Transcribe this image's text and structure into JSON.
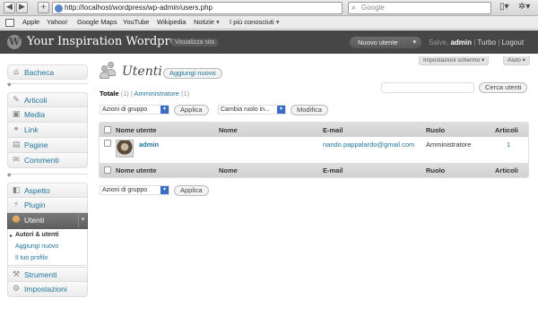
{
  "browser": {
    "back_glyph": "◀",
    "forward_glyph": "▶",
    "add_tab_glyph": "+",
    "url": "http://localhost/wordpress/wp-admin/users.php",
    "search_placeholder": "Google",
    "search_glyph": "⌕",
    "page_menu_glyph": "▯▾",
    "tools_menu_glyph": "✲▾",
    "bookmarks": [
      "Apple",
      "Yahoo!",
      "Google Maps",
      "YouTube",
      "Wikipedia",
      "Notizie",
      "I più conosciuti"
    ],
    "bookmark_folders": [
      "Notizie",
      "I più conosciuti"
    ]
  },
  "header": {
    "logo_letter": "W",
    "site_title": "Your Inspiration Wordpress",
    "visit_site": "Visualizza sito",
    "new_user_button": "Nuovo utente",
    "new_user_arrow": "▾",
    "greeting": "Salve,",
    "username": "admin",
    "sep": "|",
    "turbo": "Turbo",
    "logout": "Logout",
    "screen_options": "Impostazioni schermo",
    "help": "Aiuto"
  },
  "sidebar": {
    "items": [
      {
        "label": "Bacheca",
        "icon": "dashboard-icon",
        "glyph": "⌂"
      },
      {
        "label": "Articoli",
        "icon": "posts-icon",
        "glyph": "✎"
      },
      {
        "label": "Media",
        "icon": "media-icon",
        "glyph": "▣"
      },
      {
        "label": "Link",
        "icon": "link-icon",
        "glyph": "⚭"
      },
      {
        "label": "Pagine",
        "icon": "pages-icon",
        "glyph": "▤"
      },
      {
        "label": "Commenti",
        "icon": "comments-icon",
        "glyph": "✉"
      },
      {
        "label": "Aspetto",
        "icon": "appearance-icon",
        "glyph": "◧"
      },
      {
        "label": "Plugin",
        "icon": "plugins-icon",
        "glyph": "⚡"
      },
      {
        "label": "Utenti",
        "icon": "users-icon",
        "glyph": "☻"
      },
      {
        "label": "Strumenti",
        "icon": "tools-icon",
        "glyph": "⚒"
      },
      {
        "label": "Impostazioni",
        "icon": "settings-icon",
        "glyph": "⚙"
      }
    ],
    "separator_glyph": "◆",
    "users_toggle": "▾",
    "users_submenu": [
      {
        "label": "Autori & utenti",
        "current": true
      },
      {
        "label": "Aggiungi nuovo",
        "current": false
      },
      {
        "label": "Il tuo profilo",
        "current": false
      }
    ],
    "current_marker": "▸"
  },
  "main": {
    "title": "Utenti",
    "add_new": "Aggiungi nuovo",
    "filters": {
      "all_label": "Totale",
      "all_count": "(1)",
      "sep": "|",
      "admin_label": "Amministratore",
      "admin_count": "(1)"
    },
    "search_value": "",
    "search_button": "Cerca utenti",
    "bulk_select_value": "Azioni di gruppo",
    "apply_button": "Applica",
    "change_role_value": "Cambia ruolo in...",
    "modify_button": "Modifica",
    "select_arrow": "▾",
    "table": {
      "headers": [
        "Nome utente",
        "Nome",
        "E-mail",
        "Ruolo",
        "Articoli"
      ],
      "rows": [
        {
          "username": "admin",
          "name": "",
          "email": "nando.pappalardo@gmail.com",
          "role": "Amministratore",
          "posts": "1"
        }
      ]
    }
  },
  "colors": {
    "header_bg": "#464646",
    "link": "#21759b",
    "active_menu": "#6d6d6d"
  }
}
